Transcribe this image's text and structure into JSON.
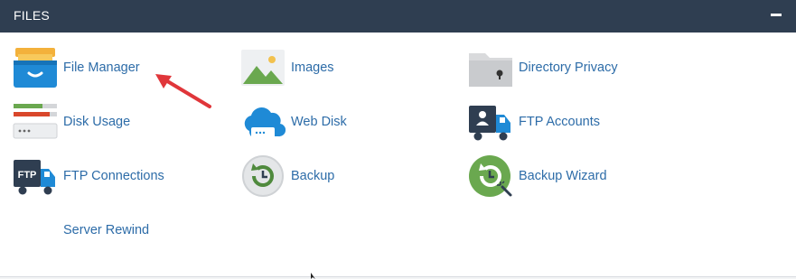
{
  "header": {
    "title": "FILES"
  },
  "items": [
    {
      "label": "File Manager",
      "icon": "file-manager-icon"
    },
    {
      "label": "Images",
      "icon": "images-icon"
    },
    {
      "label": "Directory Privacy",
      "icon": "directory-privacy-icon"
    },
    {
      "label": "Disk Usage",
      "icon": "disk-usage-icon"
    },
    {
      "label": "Web Disk",
      "icon": "web-disk-icon"
    },
    {
      "label": "FTP Accounts",
      "icon": "ftp-accounts-icon"
    },
    {
      "label": "FTP Connections",
      "icon": "ftp-connections-icon"
    },
    {
      "label": "Backup",
      "icon": "backup-icon"
    },
    {
      "label": "Backup Wizard",
      "icon": "backup-wizard-icon"
    },
    {
      "label": "Server Rewind",
      "icon": ""
    }
  ],
  "icon_text": {
    "ftp": "FTP"
  },
  "colors": {
    "header_bg": "#2f3e51",
    "link": "#2d6ca8",
    "accent_blue": "#1f8ad6",
    "accent_green": "#6aa84f",
    "arrow_red": "#e0363a"
  }
}
